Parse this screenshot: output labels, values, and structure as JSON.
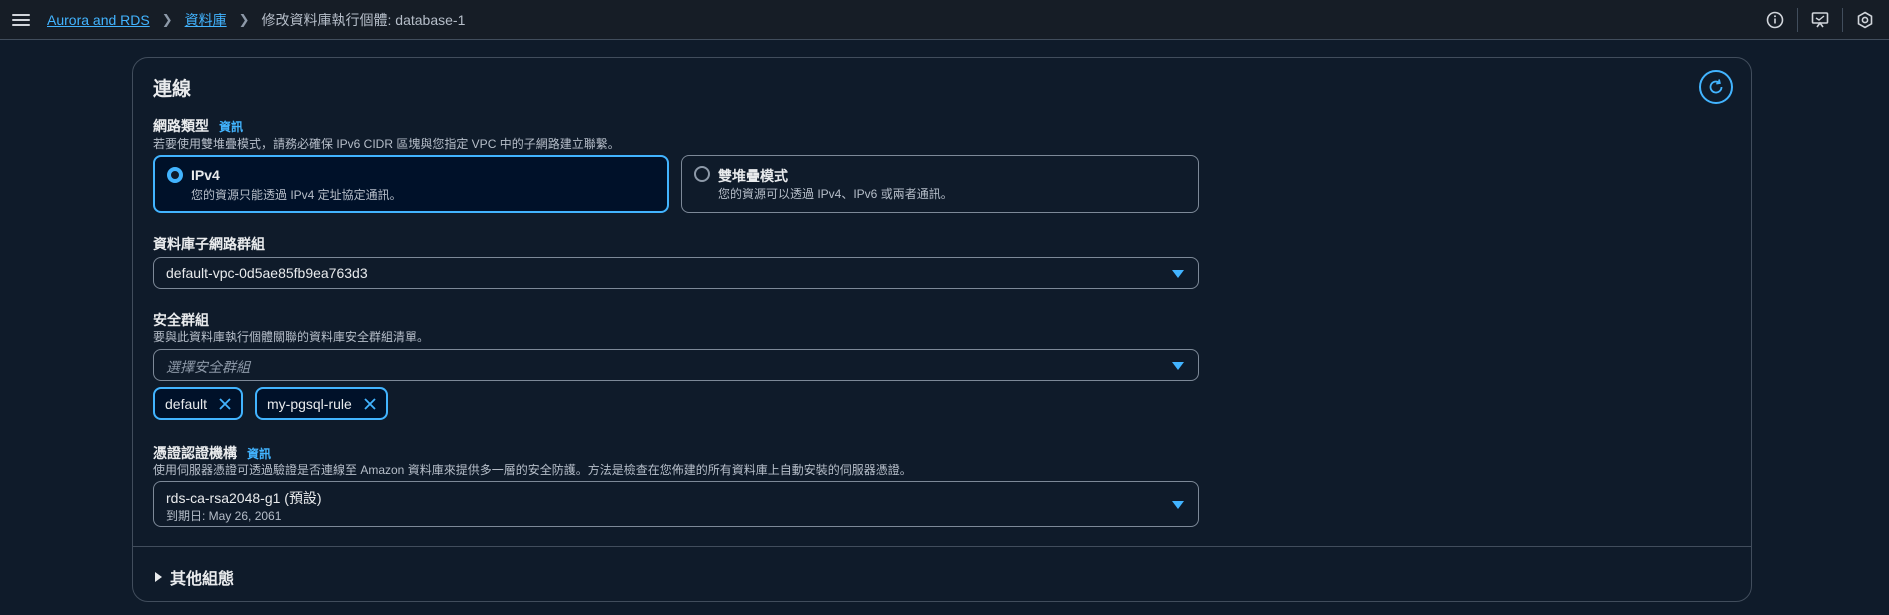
{
  "header": {
    "breadcrumbs": [
      {
        "label": "Aurora and RDS"
      },
      {
        "label": "資料庫"
      },
      {
        "label": "修改資料庫執行個體: database-1"
      }
    ],
    "icons": [
      "info-icon",
      "feedback-icon",
      "settings-icon"
    ]
  },
  "panel": {
    "title": "連線",
    "network_type": {
      "label": "網路類型",
      "info": "資訊",
      "description": "若要使用雙堆疊模式，請務必確保 IPv6 CIDR 區塊與您指定 VPC 中的子網路建立聯繫。",
      "options": [
        {
          "title": "IPv4",
          "description": "您的資源只能透過 IPv4 定址協定通訊。",
          "selected": true
        },
        {
          "title": "雙堆疊模式",
          "description": "您的資源可以透過 IPv4、IPv6 或兩者通訊。",
          "selected": false
        }
      ]
    },
    "subnet_group": {
      "label": "資料庫子網路群組",
      "value": "default-vpc-0d5ae85fb9ea763d3"
    },
    "security_group": {
      "label": "安全群組",
      "description": "要與此資料庫執行個體關聯的資料庫安全群組清單。",
      "placeholder": "選擇安全群組",
      "tokens": [
        "default",
        "my-pgsql-rule"
      ]
    },
    "certificate": {
      "label": "憑證認證機構",
      "info": "資訊",
      "description": "使用伺服器憑證可透過驗證是否連線至 Amazon 資料庫來提供多一層的安全防護。方法是檢查在您佈建的所有資料庫上自動安裝的伺服器憑證。",
      "value": "rds-ca-rsa2048-g1 (預設)",
      "expiry": "到期日: May 26, 2061"
    },
    "additional_config": "其他組態"
  },
  "colors": {
    "background": "#0f1b2a",
    "accent": "#42b4ff",
    "border": "#414d5c",
    "text": "#e9ebed"
  }
}
